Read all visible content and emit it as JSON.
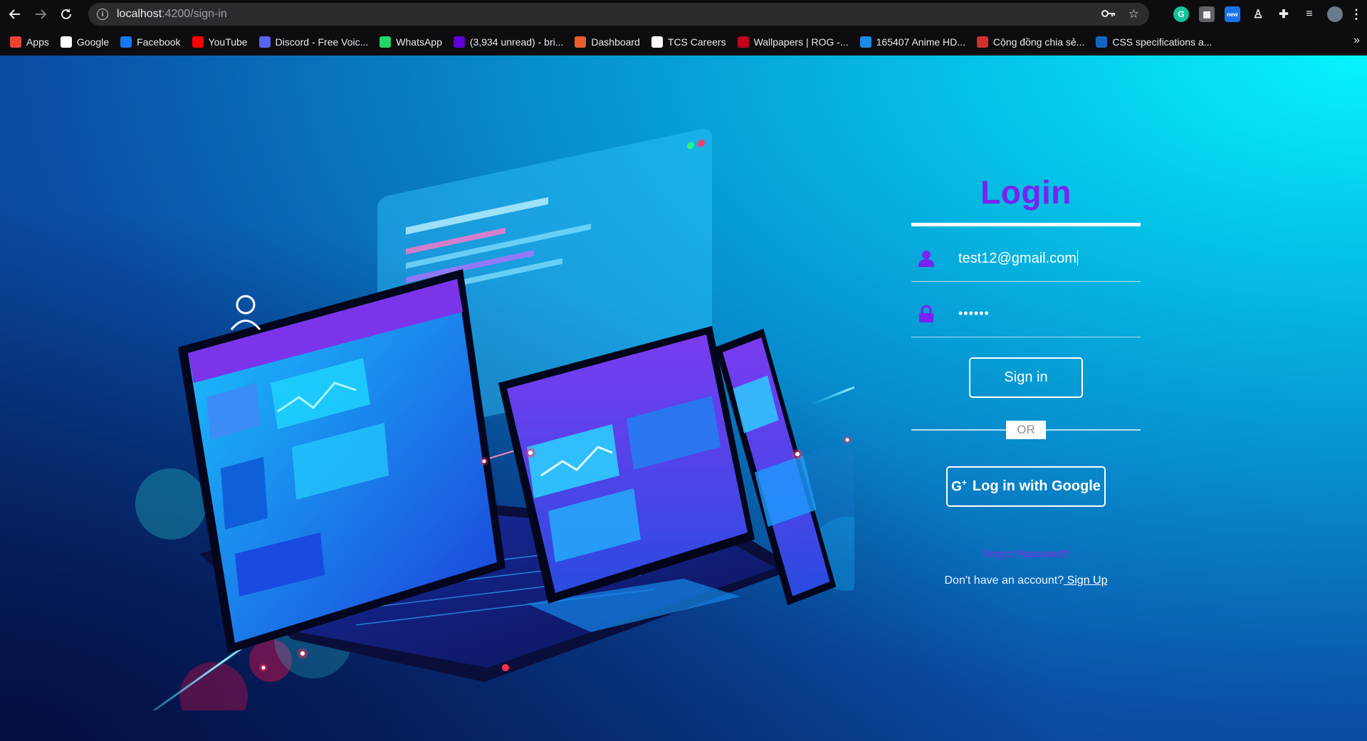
{
  "browser": {
    "url_host": "localhost",
    "url_path": ":4200/sign-in",
    "bookmarks": [
      {
        "label": "Apps",
        "icon": "apps-grid-icon",
        "color": "#ea4335"
      },
      {
        "label": "Google",
        "icon": "google-icon",
        "color": "#ffffff"
      },
      {
        "label": "Facebook",
        "icon": "facebook-icon",
        "color": "#1877f2"
      },
      {
        "label": "YouTube",
        "icon": "youtube-icon",
        "color": "#ff0000"
      },
      {
        "label": "Discord - Free Voic...",
        "icon": "discord-icon",
        "color": "#5865f2"
      },
      {
        "label": "WhatsApp",
        "icon": "whatsapp-icon",
        "color": "#25d366"
      },
      {
        "label": "(3,934 unread) - bri...",
        "icon": "mail-icon",
        "color": "#6001d2"
      },
      {
        "label": "Dashboard",
        "icon": "dashboard-icon",
        "color": "#e85d2b"
      },
      {
        "label": "TCS Careers",
        "icon": "tcs-icon",
        "color": "#ffffff"
      },
      {
        "label": "Wallpapers | ROG -...",
        "icon": "rog-icon",
        "color": "#c4001e"
      },
      {
        "label": "165407 Anime HD...",
        "icon": "wallpaper-icon",
        "color": "#1e88e5"
      },
      {
        "label": "Cộng đồng chia sẻ...",
        "icon": "community-icon",
        "color": "#d32f2f"
      },
      {
        "label": "CSS specifications a...",
        "icon": "css-icon",
        "color": "#1565c0"
      }
    ]
  },
  "login": {
    "title": "Login",
    "email_value": "test12@gmail.com",
    "password_value": "••••••",
    "signin_label": "Sign in",
    "or_label": "OR",
    "google_label": "Log in with Google",
    "google_icon_text": "G",
    "forgot_label": "Forgot Password?",
    "no_account_text": "Don't have an account?",
    "signup_label": " Sign Up",
    "accent_color": "#7a22f0"
  }
}
